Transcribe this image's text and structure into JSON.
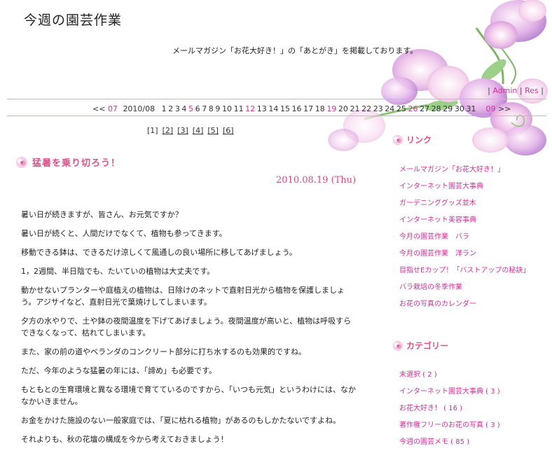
{
  "site": {
    "title": "今週の園芸作業",
    "description": "メールマガジン「お花大好き！」の「あとがき」を掲載しております。"
  },
  "admin": {
    "prefix": "|",
    "admin_label": "Admin",
    "sep": "|",
    "res_label": "Res",
    "suffix": "|"
  },
  "calendar": {
    "prev_arrow": "<<",
    "prev_month": "07",
    "current": "2010/08",
    "days": [
      {
        "d": "1",
        "linked": false
      },
      {
        "d": "2",
        "linked": false
      },
      {
        "d": "3",
        "linked": false
      },
      {
        "d": "4",
        "linked": false
      },
      {
        "d": "5",
        "linked": true
      },
      {
        "d": "6",
        "linked": false
      },
      {
        "d": "7",
        "linked": false
      },
      {
        "d": "8",
        "linked": false
      },
      {
        "d": "9",
        "linked": false
      },
      {
        "d": "10",
        "linked": false
      },
      {
        "d": "11",
        "linked": false
      },
      {
        "d": "12",
        "linked": true
      },
      {
        "d": "13",
        "linked": false
      },
      {
        "d": "14",
        "linked": false
      },
      {
        "d": "15",
        "linked": false
      },
      {
        "d": "16",
        "linked": false
      },
      {
        "d": "17",
        "linked": false
      },
      {
        "d": "18",
        "linked": false
      },
      {
        "d": "19",
        "linked": true
      },
      {
        "d": "20",
        "linked": false
      },
      {
        "d": "21",
        "linked": false
      },
      {
        "d": "22",
        "linked": false
      },
      {
        "d": "23",
        "linked": false
      },
      {
        "d": "24",
        "linked": false
      },
      {
        "d": "25",
        "linked": false
      },
      {
        "d": "26",
        "linked": true
      },
      {
        "d": "27",
        "linked": false
      },
      {
        "d": "28",
        "linked": false
      },
      {
        "d": "29",
        "linked": false
      },
      {
        "d": "30",
        "linked": false
      },
      {
        "d": "31",
        "linked": false
      }
    ],
    "next_month": "09",
    "next_arrow": ">>"
  },
  "pager": [
    "[1]",
    "[2]",
    "[3]",
    "[4]",
    "[5]",
    "[6]"
  ],
  "entry": {
    "title": "猛暑を乗り切ろう！",
    "date": "2010.08.19 (Thu)",
    "paragraphs": [
      "暑い日が続きますが、皆さん、お元気ですか？",
      "暑い日が続くと、人間だけでなくて、植物も参ってきます。",
      "移動できる鉢は、できるだけ涼しくて風通しの良い場所に移してあげましょう。",
      "1，2週間、半日陰でも、たいていの植物は大丈夫です。",
      "動かせないプランターや庭植えの植物は、日除けのネットで直射日光から植物を保護しましょう。アジサイなど、直射日光で葉焼けしてしまいます。",
      "夕方の水やりで、土や鉢の夜間温度を下げてあげましょう。夜間温度が高いと、植物は呼吸すらできなくなって、枯れてしまいます。",
      "また、家の前の道やベランダのコンクリート部分に打ち水するのも効果的ですね。",
      "ただ、今年のような猛暑の年には、「諦め」も必要です。",
      "もともとの生育環境と異なる環境で育てているのですから、「いつも元気」というわけには、なかなかいきません。",
      "お金をかけた施設のない一般家庭では、「夏に枯れる植物」があるのもしかたないですよね。",
      "それよりも、秋の花壇の構成を今から考えておきましょう！"
    ]
  },
  "sidebar": {
    "links_heading": "リンク",
    "links": [
      "メールマガジン「お花大好き！」",
      "インターネット園芸大事典",
      "ガーデニンググッズ並木",
      "インターネット美容事典",
      "今月の園芸作業　バラ",
      "今月の園芸作業　洋ラン",
      "目指せEカップ！「バストアップの秘訣」",
      "バラ栽培の冬季作業",
      "お花の写真のカレンダー"
    ],
    "categories_heading": "カテゴリー",
    "categories": [
      "未選択 ( 2 )",
      "インターネット園芸大事典 ( 3 )",
      "お花大好き！ ( 16 )",
      "著作権フリーのお花の写真 ( 3 )",
      "今週の園芸メモ ( 85 )"
    ]
  },
  "colors": {
    "accent": "#e0508a",
    "link": "#cc3399",
    "rule": "#e9a7b8"
  },
  "icons": {
    "bullet": "flower-bullet-icon",
    "decoration": "sweet-pea-flowers"
  }
}
